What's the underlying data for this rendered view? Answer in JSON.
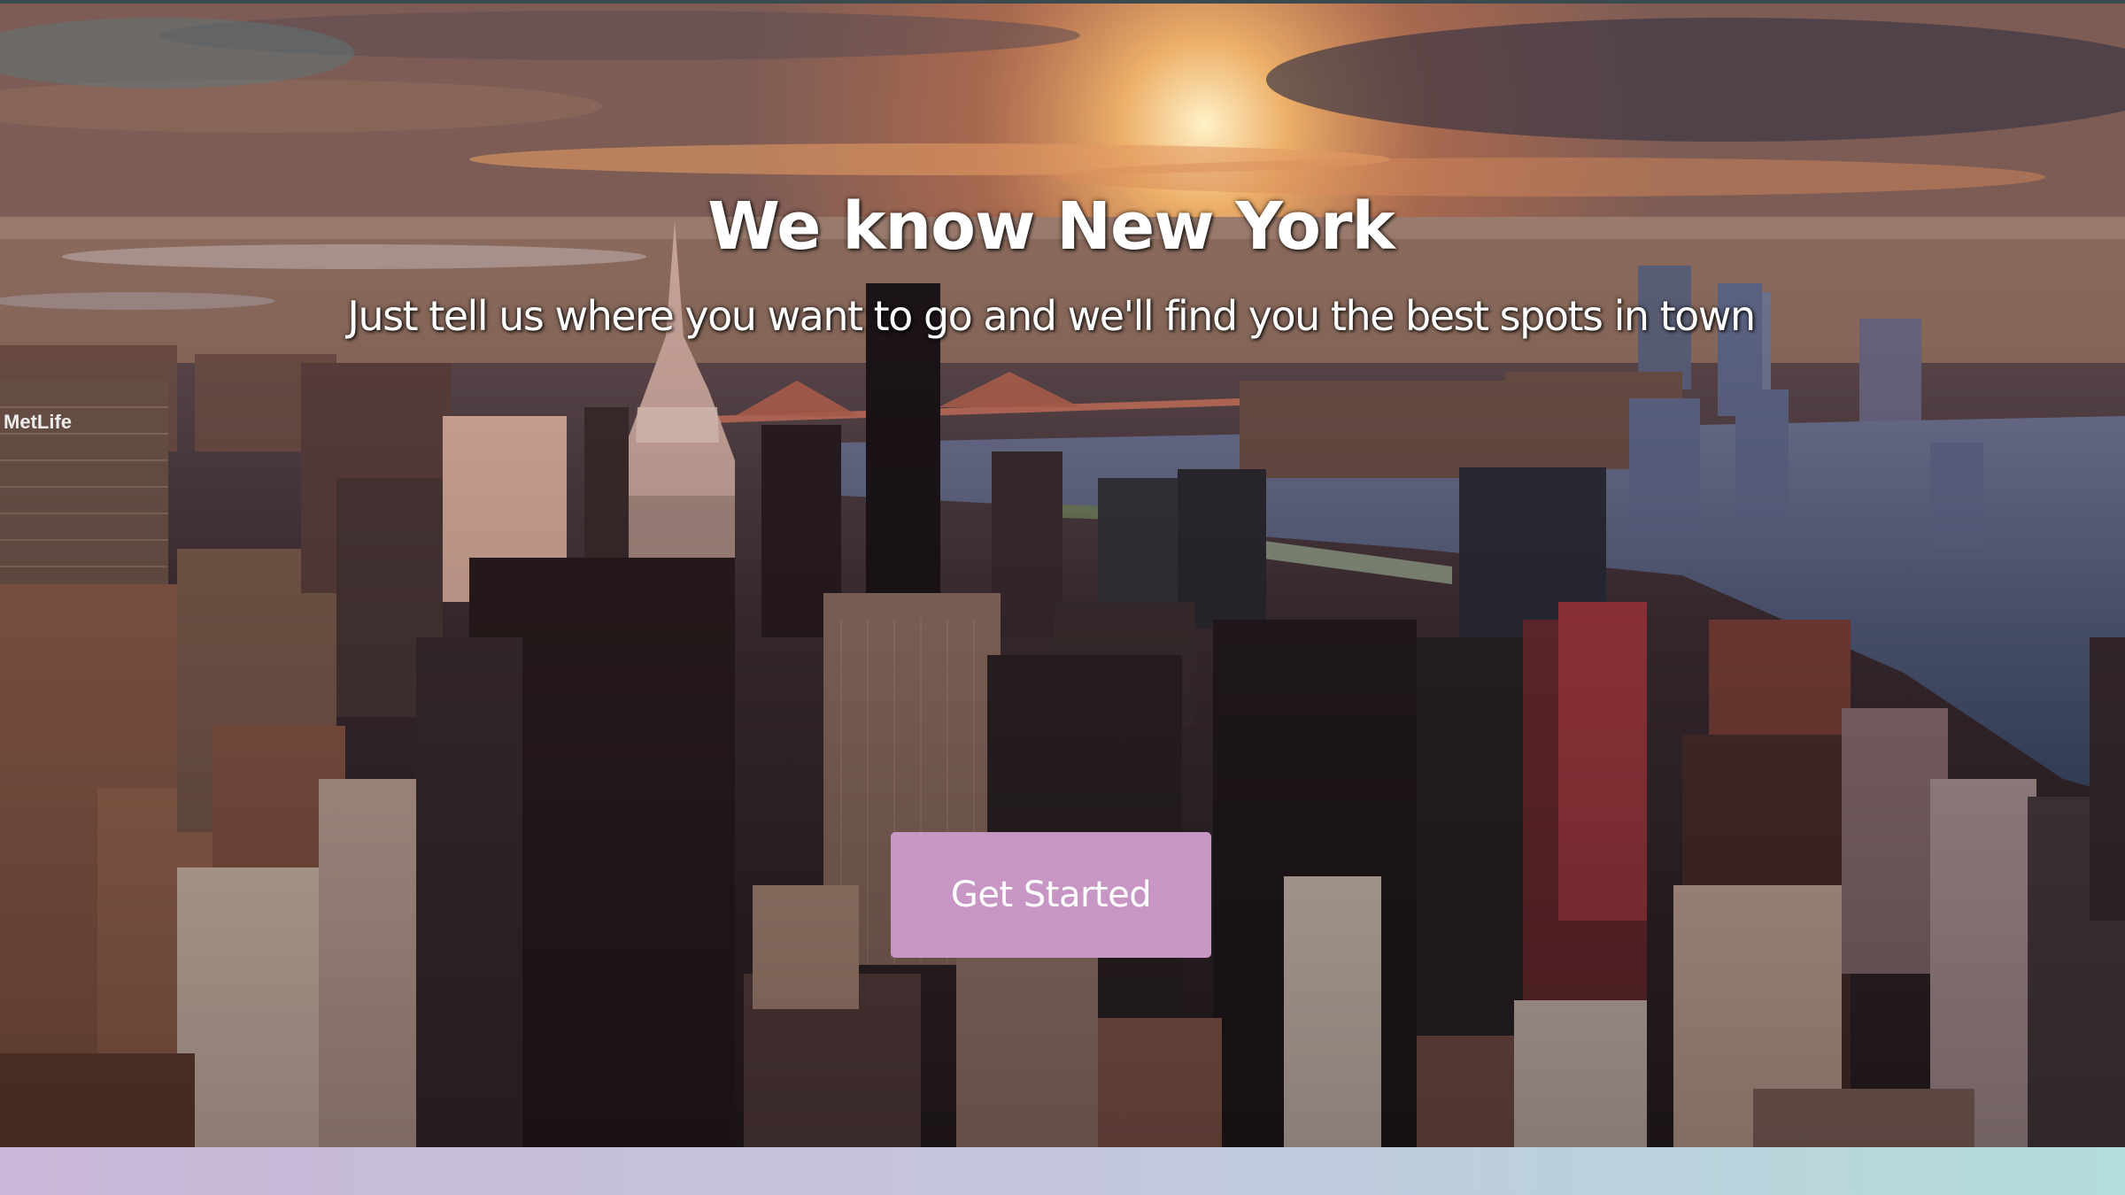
{
  "hero": {
    "headline": "We know New York",
    "subheadline": "Just tell us where you want to go and we'll find you the best spots in town",
    "cta_label": "Get Started",
    "photo_icon": "city-skyline-photo",
    "photo_lettering": "MetLife"
  },
  "colors": {
    "cta_background": "#c896c5",
    "footer_gradient_start": "#c9b6d8",
    "footer_gradient_end": "#b3dcdc"
  }
}
